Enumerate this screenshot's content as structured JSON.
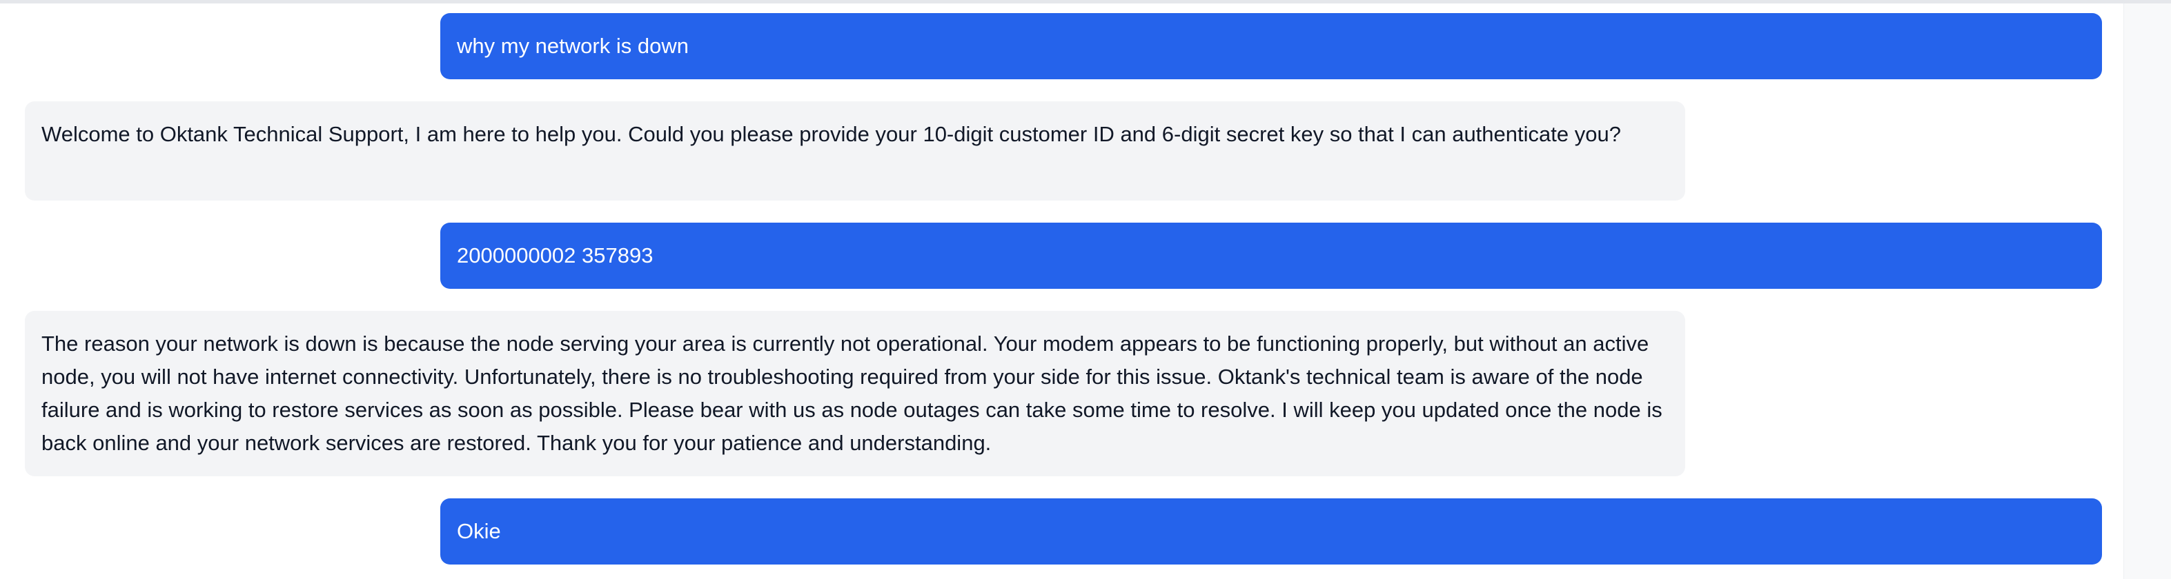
{
  "conversation": {
    "messages": [
      {
        "role": "user",
        "text": "why my network is down"
      },
      {
        "role": "assistant",
        "text": "Welcome to Oktank Technical Support, I am here to help you. Could you please provide your 10-digit customer ID and 6-digit secret key so that I can authenticate you?"
      },
      {
        "role": "user",
        "text": "2000000002 357893"
      },
      {
        "role": "assistant",
        "text": "The reason your network is down is because the node serving your area is currently not operational. Your modem appears to be functioning properly, but without an active node, you will not have internet connectivity. Unfortunately, there is no troubleshooting required from your side for this issue. Oktank's technical team is aware of the node failure and is working to restore services as soon as possible. Please bear with us as node outages can take some time to resolve. I will keep you updated once the node is back online and your network services are restored. Thank you for your patience and understanding."
      },
      {
        "role": "user",
        "text": "Okie"
      }
    ]
  },
  "colors": {
    "user_bubble": "#2563eb",
    "assistant_bubble": "#f3f4f6",
    "user_text": "#ffffff",
    "assistant_text": "#111827"
  }
}
